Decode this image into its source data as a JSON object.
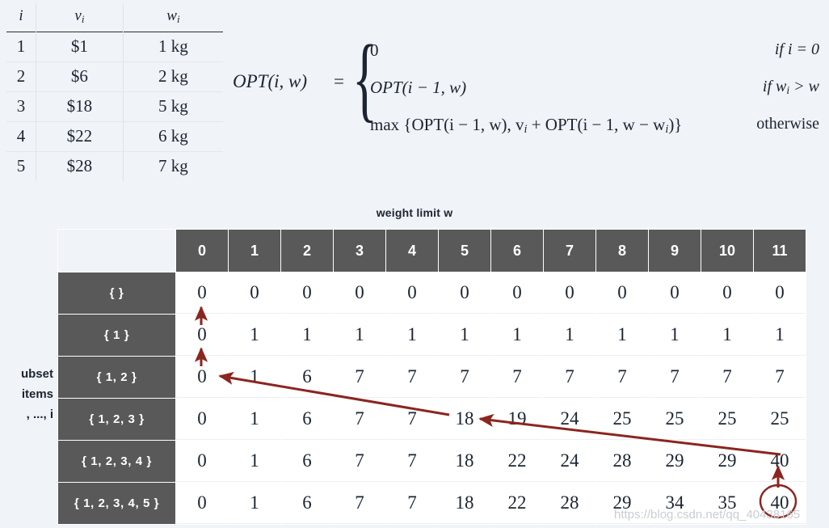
{
  "background_color": "#f0f3f7",
  "accent_color": "#8b2520",
  "header_color": "#595959",
  "item_table": {
    "name": "knapsack-items",
    "headers": [
      "i",
      "v",
      "w"
    ],
    "header_display": [
      "i",
      "vi",
      "wi"
    ],
    "rows": [
      {
        "i": "1",
        "value": "$1",
        "weight": "1 kg"
      },
      {
        "i": "2",
        "value": "$6",
        "weight": "2 kg"
      },
      {
        "i": "3",
        "value": "$18",
        "weight": "5 kg"
      },
      {
        "i": "4",
        "value": "$22",
        "weight": "6 kg"
      },
      {
        "i": "5",
        "value": "$28",
        "weight": "7 kg"
      }
    ]
  },
  "formula": {
    "lhs": "OPT(i, w)",
    "equals": "=",
    "cases": [
      {
        "expr": "0",
        "cond": "if i = 0"
      },
      {
        "expr": "OPT(i − 1, w)",
        "cond": "if wi > w"
      },
      {
        "expr": "max {OPT(i − 1, w), vi + OPT(i − 1, w − wi)}",
        "cond": "otherwise"
      }
    ]
  },
  "dp": {
    "top_label": "weight limit w",
    "side_label_lines": [
      "ubset",
      "items",
      ", ..., i"
    ],
    "column_headers": [
      "0",
      "1",
      "2",
      "3",
      "4",
      "5",
      "6",
      "7",
      "8",
      "9",
      "10",
      "11"
    ],
    "row_headers": [
      "{  }",
      "{ 1 }",
      "{ 1, 2 }",
      "{ 1, 2, 3 }",
      "{ 1, 2, 3, 4 }",
      "{ 1, 2, 3, 4, 5 }"
    ],
    "rows": [
      [
        "0",
        "0",
        "0",
        "0",
        "0",
        "0",
        "0",
        "0",
        "0",
        "0",
        "0",
        "0"
      ],
      [
        "0",
        "1",
        "1",
        "1",
        "1",
        "1",
        "1",
        "1",
        "1",
        "1",
        "1",
        "1"
      ],
      [
        "0",
        "1",
        "6",
        "7",
        "7",
        "7",
        "7",
        "7",
        "7",
        "7",
        "7",
        "7"
      ],
      [
        "0",
        "1",
        "6",
        "7",
        "7",
        "18",
        "19",
        "24",
        "25",
        "25",
        "25",
        "25"
      ],
      [
        "0",
        "1",
        "6",
        "7",
        "7",
        "18",
        "22",
        "24",
        "28",
        "29",
        "29",
        "40"
      ],
      [
        "0",
        "1",
        "6",
        "7",
        "7",
        "18",
        "22",
        "28",
        "29",
        "34",
        "35",
        "40"
      ]
    ],
    "highlighted_cell": "40"
  },
  "watermark": "https://blog.csdn.net/qq_40438165"
}
